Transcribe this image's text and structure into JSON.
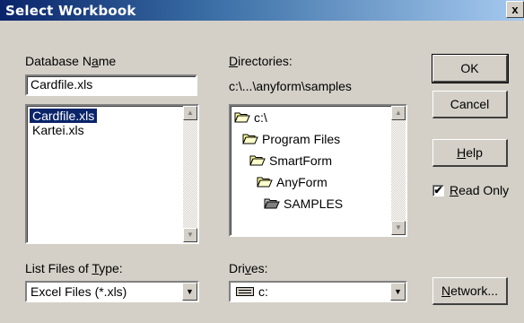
{
  "dialog": {
    "title": "Select Workbook",
    "close_label": "x"
  },
  "database": {
    "label_pre": "Database N",
    "label_key": "a",
    "label_post": "me",
    "value": "Cardfile.xls",
    "files": [
      {
        "name": "Cardfile.xls",
        "selected": true
      },
      {
        "name": "Kartei.xls",
        "selected": false
      }
    ]
  },
  "directories": {
    "label_key": "D",
    "label_post": "irectories:",
    "path": "c:\\...\\anyform\\samples",
    "tree": [
      {
        "name": "c:\\",
        "level": 0,
        "open": true
      },
      {
        "name": "Program Files",
        "level": 1,
        "open": true
      },
      {
        "name": "SmartForm",
        "level": 2,
        "open": true
      },
      {
        "name": "AnyForm",
        "level": 3,
        "open": true
      },
      {
        "name": "SAMPLES",
        "level": 4,
        "open": true
      }
    ]
  },
  "filetype": {
    "label_pre": "List Files of ",
    "label_key": "T",
    "label_post": "ype:",
    "value": "Excel Files (*.xls)"
  },
  "drives": {
    "label_pre": "Dri",
    "label_key": "v",
    "label_post": "es:",
    "value": "c:"
  },
  "buttons": {
    "ok": "OK",
    "cancel": "Cancel",
    "help_key": "H",
    "help_post": "elp",
    "network_key": "N",
    "network_post": "etwork..."
  },
  "readonly": {
    "checked": true,
    "check_mark": "✔",
    "label_key": "R",
    "label_post": "ead Only"
  },
  "colors": {
    "face": "#d4d0c8",
    "selection": "#0a246a",
    "title_start": "#0a246a",
    "title_end": "#a6caf0"
  }
}
